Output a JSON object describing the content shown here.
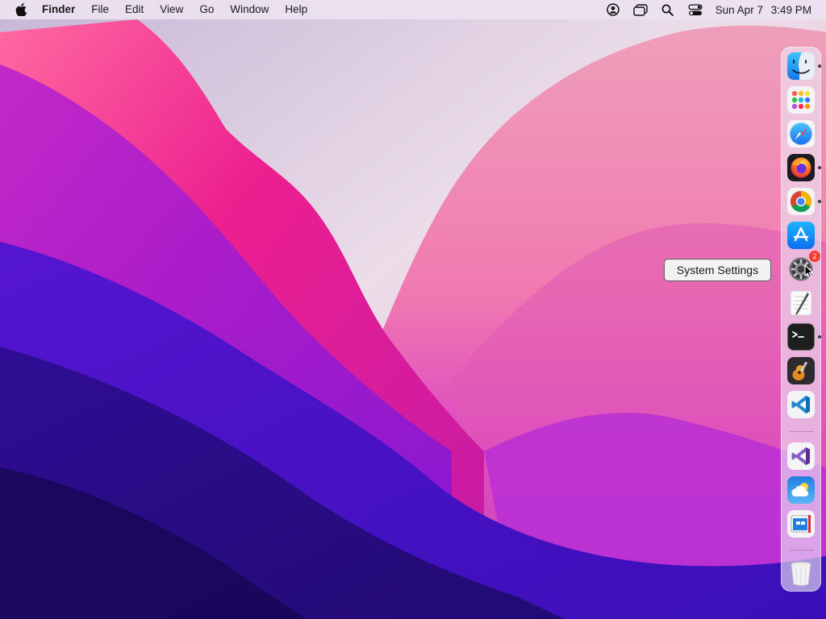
{
  "menubar": {
    "apple_icon": "apple-logo-icon",
    "app_name": "Finder",
    "menus": [
      "File",
      "Edit",
      "View",
      "Go",
      "Window",
      "Help"
    ],
    "status_icons": [
      "user-account-icon",
      "screen-mirroring-icon",
      "spotlight-search-icon",
      "control-center-icon"
    ],
    "clock": {
      "date": "Sun Apr 7",
      "time": "3:49 PM"
    }
  },
  "dock": {
    "apps": [
      {
        "name": "Finder",
        "icon": "finder-icon",
        "running": true
      },
      {
        "name": "Launchpad",
        "icon": "launchpad-icon",
        "running": false
      },
      {
        "name": "Safari",
        "icon": "safari-icon",
        "running": false
      },
      {
        "name": "Firefox",
        "icon": "firefox-icon",
        "running": true
      },
      {
        "name": "Google Chrome",
        "icon": "chrome-icon",
        "running": true
      },
      {
        "name": "App Store",
        "icon": "app-store-icon",
        "running": false
      },
      {
        "name": "System Settings",
        "icon": "system-settings-icon",
        "running": false,
        "badge": "2"
      },
      {
        "name": "TextEdit",
        "icon": "textedit-icon",
        "running": false
      },
      {
        "name": "Terminal",
        "icon": "terminal-icon",
        "running": true
      },
      {
        "name": "GarageBand",
        "icon": "garageband-icon",
        "running": false
      },
      {
        "name": "Visual Studio Code",
        "icon": "vscode-icon",
        "running": false
      }
    ],
    "recent_apps": [
      {
        "name": "Visual Studio",
        "icon": "visual-studio-icon"
      },
      {
        "name": "Weather",
        "icon": "weather-icon"
      },
      {
        "name": "Microsoft Remote Desktop",
        "icon": "remote-desktop-icon"
      }
    ],
    "trash": {
      "name": "Trash",
      "icon": "trash-icon"
    }
  },
  "tooltip": {
    "text": "System Settings"
  },
  "colors": {
    "menubar_bg": "#ebe2f0",
    "wallpaper_pink": "#e0128f",
    "wallpaper_violet": "#5a12c9",
    "wallpaper_light": "#ecd9e8",
    "badge_red": "#ff3b30"
  }
}
